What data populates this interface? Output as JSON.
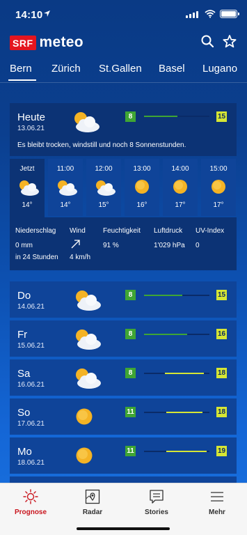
{
  "status_bar": {
    "time": "14:10"
  },
  "header": {
    "brand": "SRF",
    "app_name": "meteo"
  },
  "tabs": [
    {
      "label": "Bern",
      "active": true
    },
    {
      "label": "Zürich"
    },
    {
      "label": "St.Gallen"
    },
    {
      "label": "Basel"
    },
    {
      "label": "Lugano"
    }
  ],
  "today": {
    "day": "Heute",
    "date": "13.06.21",
    "icon": "sun-cloud",
    "min": "8",
    "max": "15",
    "description": "Es bleibt trocken, windstill und noch 8 Sonnenstunden."
  },
  "hourly": [
    {
      "time": "Jetzt",
      "icon": "sun-cloud",
      "temp": "14°",
      "active": true
    },
    {
      "time": "11:00",
      "icon": "sun-cloud",
      "temp": "14°"
    },
    {
      "time": "12:00",
      "icon": "sun-cloud",
      "temp": "15°"
    },
    {
      "time": "13:00",
      "icon": "sun",
      "temp": "16°"
    },
    {
      "time": "14:00",
      "icon": "sun",
      "temp": "17°"
    },
    {
      "time": "15:00",
      "icon": "sun",
      "temp": "17°"
    }
  ],
  "details": {
    "precip_label": "Niederschlag",
    "precip_value": "0 mm",
    "precip_sub": "in 24 Stunden",
    "wind_label": "Wind",
    "wind_value": "4 km/h",
    "humidity_label": "Feuchtigkeit",
    "humidity_value": "91 %",
    "pressure_label": "Luftdruck",
    "pressure_value": "1'029 hPa",
    "uv_label": "UV-Index",
    "uv_value": "0"
  },
  "forecast": [
    {
      "day": "Do",
      "date": "14.06.21",
      "icon": "sun-cloud",
      "min": "8",
      "max": "15"
    },
    {
      "day": "Fr",
      "date": "15.06.21",
      "icon": "sun-cloud",
      "min": "8",
      "max": "16"
    },
    {
      "day": "Sa",
      "date": "16.06.21",
      "icon": "sun-cloud",
      "min": "8",
      "max": "18"
    },
    {
      "day": "So",
      "date": "17.06.21",
      "icon": "sun",
      "min": "11",
      "max": "18"
    },
    {
      "day": "Mo",
      "date": "18.06.21",
      "icon": "sun",
      "min": "11",
      "max": "19"
    }
  ],
  "nav": [
    {
      "label": "Prognose",
      "icon": "sun-outline-icon",
      "active": true
    },
    {
      "label": "Radar",
      "icon": "map-pin-icon"
    },
    {
      "label": "Stories",
      "icon": "chat-bubble-icon"
    },
    {
      "label": "Mehr",
      "icon": "menu-icon"
    }
  ],
  "colors": {
    "accent_red": "#c9151e",
    "min_badge": "#3fa534",
    "max_badge": "#d6e634"
  }
}
